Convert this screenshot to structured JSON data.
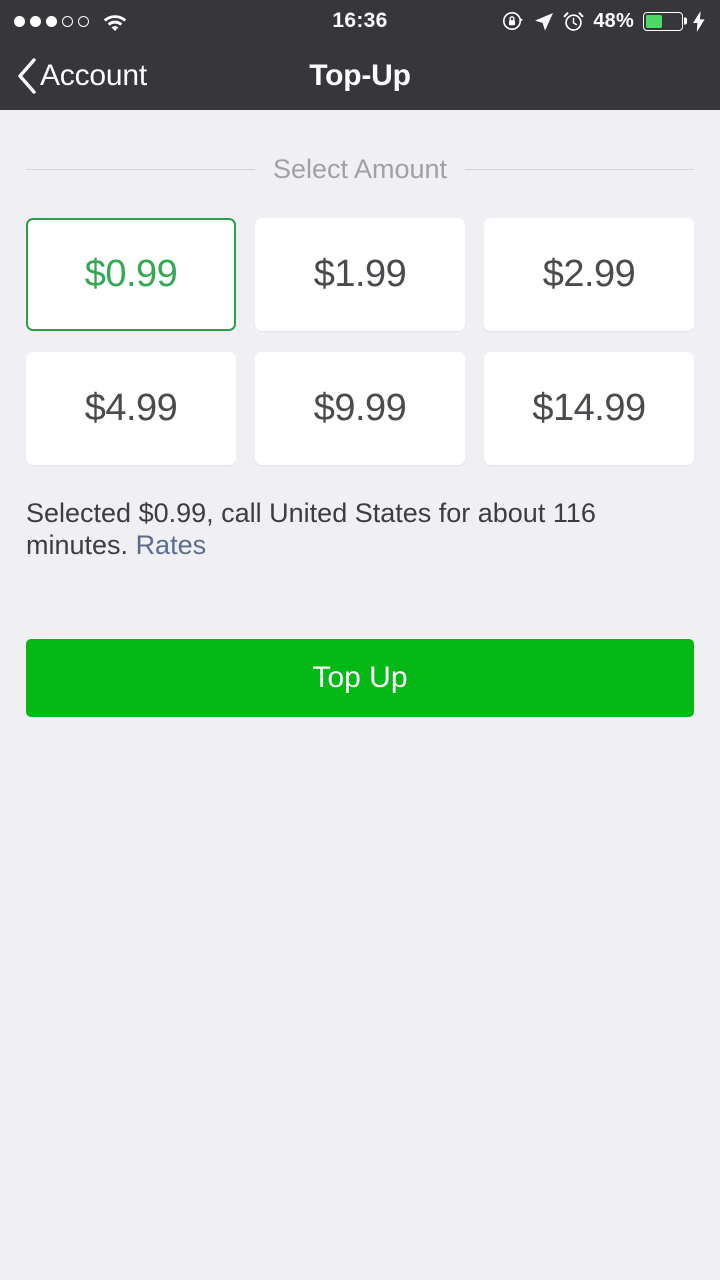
{
  "status_bar": {
    "signal_dots_filled": 3,
    "signal_dots_total": 5,
    "wifi_icon": "wifi-icon",
    "time": "16:36",
    "rotation_lock_icon": "rotation-lock-icon",
    "location_icon": "location-arrow-icon",
    "alarm_icon": "alarm-clock-icon",
    "battery_percent_label": "48%",
    "battery_level": 48,
    "battery_color": "#4cd964",
    "charging_icon": "lightning-bolt-icon"
  },
  "nav": {
    "back_icon": "chevron-left-icon",
    "back_label": "Account",
    "title": "Top-Up"
  },
  "section": {
    "title": "Select Amount"
  },
  "amounts": [
    {
      "label": "$0.99",
      "selected": true
    },
    {
      "label": "$1.99",
      "selected": false
    },
    {
      "label": "$2.99",
      "selected": false
    },
    {
      "label": "$4.99",
      "selected": false
    },
    {
      "label": "$9.99",
      "selected": false
    },
    {
      "label": "$14.99",
      "selected": false
    }
  ],
  "summary": {
    "text": "Selected $0.99, call United States for about 116 minutes.",
    "link_label": "Rates"
  },
  "action": {
    "topup_label": "Top Up"
  },
  "colors": {
    "accent_green": "#04b915",
    "selected_border": "#2e9e4c",
    "selected_text": "#34a853",
    "nav_background": "#36363b",
    "page_background": "#efeff4",
    "link": "#5a6e8c"
  }
}
